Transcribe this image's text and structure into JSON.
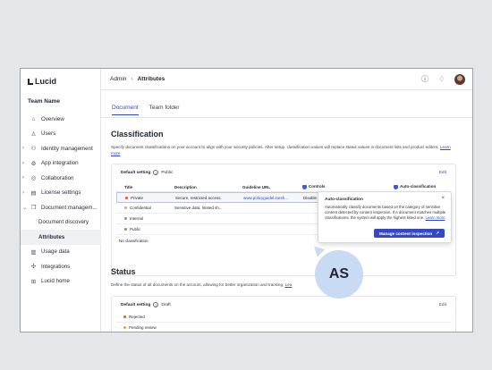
{
  "sidebar": {
    "logo": "Lucid",
    "team_name": "Team Name",
    "items": [
      {
        "label": "Overview",
        "icon": "home-icon"
      },
      {
        "label": "Users",
        "icon": "user-icon"
      },
      {
        "label": "Identity management",
        "icon": "id-icon"
      },
      {
        "label": "App integration",
        "icon": "gear-icon"
      },
      {
        "label": "Collaboration",
        "icon": "globe-icon"
      },
      {
        "label": "License settings",
        "icon": "license-icon"
      },
      {
        "label": "Document managem...",
        "icon": "document-icon"
      },
      {
        "label": "Document discovery"
      },
      {
        "label": "Attributes"
      },
      {
        "label": "Usage data",
        "icon": "chart-icon"
      },
      {
        "label": "Integrations",
        "icon": "integrations-icon"
      },
      {
        "label": "Lucid home",
        "icon": "grid-icon"
      }
    ]
  },
  "breadcrumb": {
    "root": "Admin",
    "separator": "›",
    "current": "Attributes"
  },
  "tabs": [
    "Document",
    "Team folder"
  ],
  "classification": {
    "title": "Classification",
    "description": "Specify document classifications on your account to align with your security policies. After setup, classification values will replace status values in document lists and product editors.",
    "learn_more": "Learn more",
    "default_label": "Default setting",
    "default_value": "Public",
    "edit": "Edit",
    "columns": [
      "Title",
      "Description",
      "Guideline URL",
      "Controls",
      "Auto-classification"
    ],
    "rows": [
      {
        "title": "Private",
        "color": "#e0553b",
        "description": "Secure, restricted access.",
        "url": "www.policyguidel.inesh...",
        "controls": "Disable p..."
      },
      {
        "title": "Confidential",
        "color": "#f0a330",
        "description": "Sensitive data, limited sh...",
        "url": "",
        "controls": ""
      },
      {
        "title": "Internal",
        "color": "#4aa3df",
        "description": "",
        "url": "",
        "controls": ""
      },
      {
        "title": "Public",
        "color": "#43b36b",
        "description": "",
        "url": "",
        "controls": ""
      },
      {
        "title": "No classification",
        "color": "",
        "description": "",
        "url": "",
        "controls": ""
      }
    ]
  },
  "tooltip": {
    "title": "Auto-classification",
    "close": "×",
    "body": "Automatically classify documents based on the category of sensitive content detected by content inspection. If a document matches multiple classifications, the system will apply the highest listed one.",
    "learn_more": "Learn more",
    "button": "Manage content inspection",
    "button_icon": "external-link-icon"
  },
  "status": {
    "title": "Status",
    "description": "Define the status of all documents on the account, allowing for better organization and tracking.",
    "learn_more": "Lea",
    "default_label": "Default setting",
    "default_value": "Draft",
    "edit": "Edit",
    "rows": [
      {
        "title": "Rejected",
        "color": "#e0553b"
      },
      {
        "title": "Pending review",
        "color": "#f0a330"
      }
    ]
  },
  "badge": "AS",
  "colors": {
    "accent": "#2d4bbd",
    "button": "#3548c4",
    "badge": "#c9daf4"
  }
}
